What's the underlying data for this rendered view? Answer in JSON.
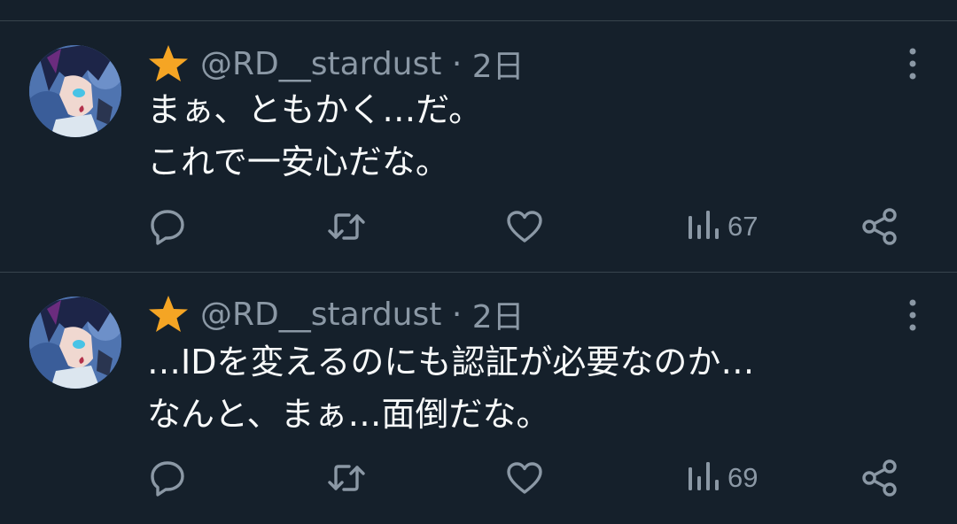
{
  "tweets": [
    {
      "handle": "@RD__stardust",
      "time": "2日",
      "lines": [
        "まぁ、ともかく…だ。",
        "これで一安心だな。"
      ],
      "views": "67"
    },
    {
      "handle": "@RD__stardust",
      "time": "2日",
      "lines": [
        "…IDを変えるのにも認証が必要なのか…",
        "なんと、まぁ…面倒だな。"
      ],
      "views": "69"
    }
  ],
  "colors": {
    "background": "#15202b",
    "text": "#f7f9f9",
    "muted": "#8b98a5",
    "star": "#f5a524",
    "divider": "#38444d"
  },
  "icons": {
    "badge": "star-icon",
    "menu": "more-icon",
    "reply": "reply-icon",
    "retweet": "retweet-icon",
    "like": "heart-icon",
    "views": "views-icon",
    "share": "share-icon"
  }
}
